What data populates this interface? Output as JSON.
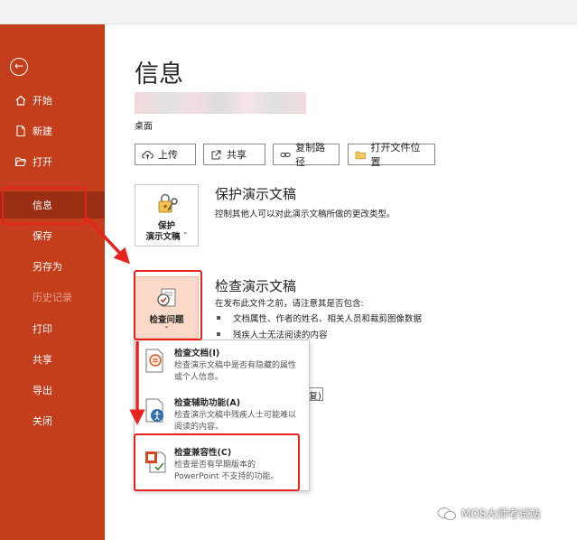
{
  "sidebar": {
    "back_icon": "back-arrow-icon",
    "items": [
      {
        "label": "开始",
        "icon": "home-icon"
      },
      {
        "label": "新建",
        "icon": "new-document-icon"
      },
      {
        "label": "打开",
        "icon": "open-folder-icon"
      },
      {
        "label": "信息",
        "active": true
      },
      {
        "label": "保存"
      },
      {
        "label": "另存为"
      },
      {
        "label": "历史记录",
        "disabled": true
      },
      {
        "label": "打印"
      },
      {
        "label": "共享"
      },
      {
        "label": "导出"
      },
      {
        "label": "关闭"
      }
    ],
    "color": "#c43e1c",
    "active_color": "#9a2e12"
  },
  "main": {
    "title": "信息",
    "location": "桌面",
    "actions": [
      {
        "label": "上传",
        "icon": "cloud-upload-icon"
      },
      {
        "label": "共享",
        "icon": "share-icon"
      },
      {
        "label": "复制路径",
        "icon": "link-icon"
      },
      {
        "label": "打开文件位置",
        "icon": "folder-icon"
      }
    ],
    "protect": {
      "button_label_line1": "保护",
      "button_label_line2": "演示文稿",
      "title": "保护演示文稿",
      "description": "控制其他人可以对此演示文稿所做的更改类型。"
    },
    "inspect": {
      "button_label": "检查问题",
      "title": "检查演示文稿",
      "description": "在发布此文件之前，请注意其是否包含:",
      "bullets": [
        "文档属性、作者的姓名、相关人员和裁剪图像数据",
        "残疾人士无法阅读的内容"
      ],
      "partial_text": "复)"
    },
    "dropdown": [
      {
        "title": "检查文档(I)",
        "description": "检查演示文稿中是否有隐藏的属性或个人信息。",
        "icon": "inspect-document-icon"
      },
      {
        "title": "检查辅助功能(A)",
        "description": "检查演示文稿中残疾人士可能难以阅读的内容。",
        "icon": "accessibility-check-icon"
      },
      {
        "title": "检查兼容性(C)",
        "description": "检查是否有早期版本的 PowerPoint 不支持的功能。",
        "icon": "compatibility-check-icon"
      }
    ]
  },
  "watermark": "MOS大师考试站",
  "highlight_color": "#e8221c"
}
